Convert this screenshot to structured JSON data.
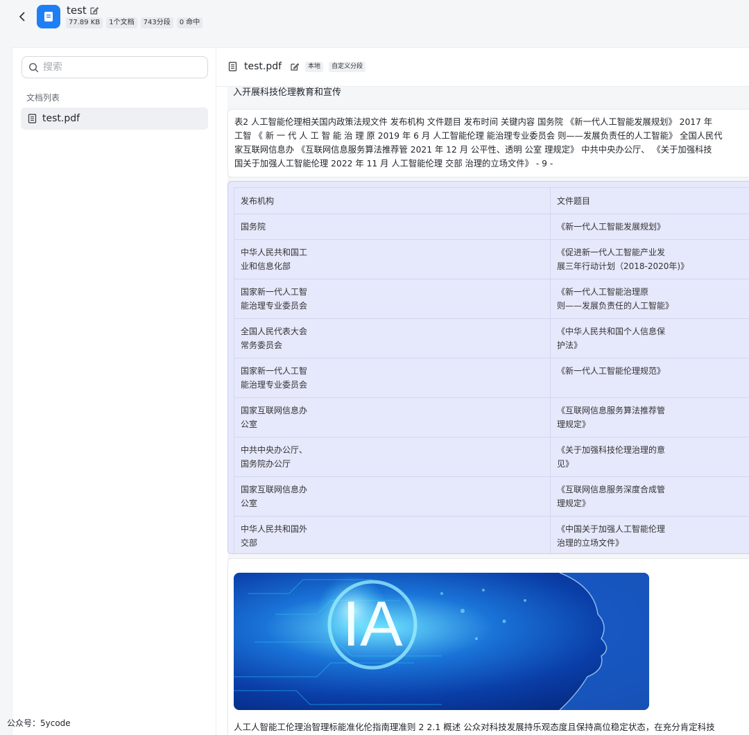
{
  "header": {
    "title": "test",
    "badges": [
      "77.89 KB",
      "1个文档",
      "743分段",
      "0 命中"
    ]
  },
  "sidebar": {
    "search_placeholder": "搜索",
    "section_label": "文档列表",
    "items": [
      {
        "label": "test.pdf"
      }
    ]
  },
  "doc": {
    "title": "test.pdf",
    "tags": [
      "本地",
      "自定义分段"
    ]
  },
  "content": {
    "top_line": "入开展科技伦理教育和宣传",
    "paragraph_lines": [
      "表2 人工智能伦理相关国内政策法规文件 发布机构 文件题目 发布时间 关键内容 国务院 《新一代人工智能发展规划》 2017 年",
      "工智 《 新 一 代 人 工 智 能 治 理 原 2019 年 6 月 人工智能伦理 能治理专业委员会 则——发展负责任的人工智能》 全国人民代",
      "家互联网信息办 《互联网信息服务算法推荐管 2021 年 12 月 公平性、透明 公室 理规定》 中共中央办公厅、 《关于加强科技",
      "国关于加强人工智能伦理 2022 年 11 月 人工智能伦理 交部 治理的立场文件》 - 9 -"
    ],
    "table": {
      "headers": [
        "发布机构",
        "文件题目"
      ],
      "rows": [
        [
          "国务院",
          "《新一代人工智能发展规划》"
        ],
        [
          "中华人民共和国工\n业和信息化部",
          "《促进新一代人工智能产业发\n展三年行动计划（2018-2020年)》"
        ],
        [
          "国家新一代人工智\n能治理专业委员会",
          "《新一代人工智能治理原\n则——发展负责任的人工智能》"
        ],
        [
          "全国人民代表大会\n常务委员会",
          "《中华人民共和国个人信息保\n护法》"
        ],
        [
          "国家新一代人工智\n能治理专业委员会",
          "《新一代人工智能伦理规范》"
        ],
        [
          "国家互联网信息办\n公室",
          "《互联网信息服务算法推荐管\n理规定》"
        ],
        [
          "中共中央办公厅、\n国务院办公厅",
          "《关于加强科技伦理治理的意\n见》"
        ],
        [
          "国家互联网信息办\n公室",
          "《互联网信息服务深度合成管\n理规定》"
        ],
        [
          "中华人民共和国外\n交部",
          "《中国关于加强人工智能伦理\n治理的立场文件》"
        ]
      ]
    },
    "image_text": "IA",
    "image_caption": "人工人智能工伦理治智理标能准化伦指南理准则 2 2.1 概述 公众对科技发展持乐观态度且保持高位稳定状态，在充分肯定科技"
  },
  "watermark": "公众号：5ycode",
  "colors": {
    "accent": "#1e7ff5",
    "table_bg": "#e6e8fb",
    "page_bg": "#f5f6f8"
  }
}
